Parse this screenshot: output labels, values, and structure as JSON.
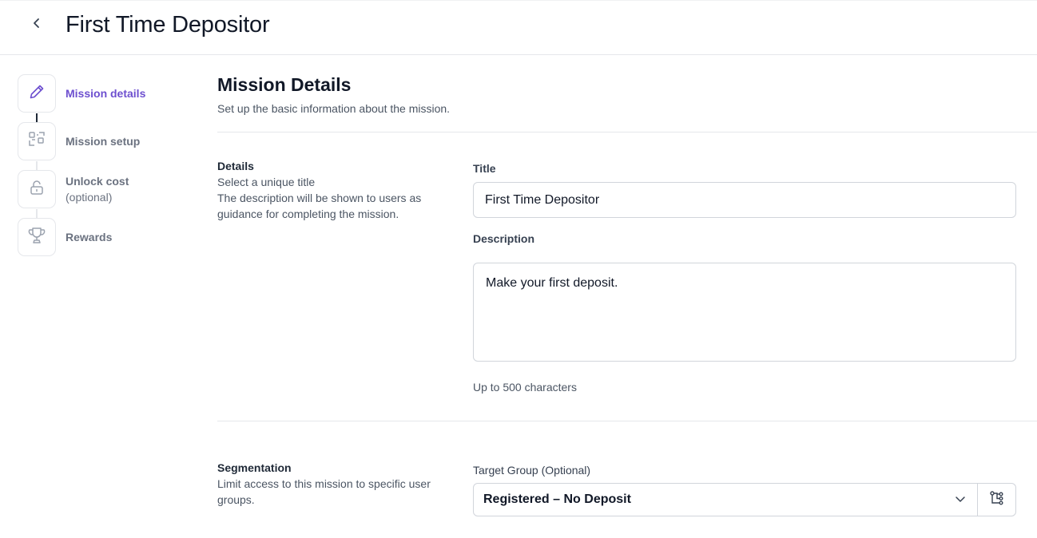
{
  "header": {
    "title": "First Time Depositor",
    "back_icon": "chevron-left-icon"
  },
  "steps": [
    {
      "label": "Mission details",
      "icon": "pencil-icon",
      "active": true
    },
    {
      "label": "Mission setup",
      "icon": "setup-icon",
      "active": false
    },
    {
      "label": "Unlock cost",
      "sublabel": "(optional)",
      "icon": "lock-icon",
      "active": false
    },
    {
      "label": "Rewards",
      "icon": "trophy-icon",
      "active": false
    }
  ],
  "section": {
    "title": "Mission Details",
    "subtitle": "Set up the basic information about the mission."
  },
  "details": {
    "title": "Details",
    "desc_line1": "Select a unique title",
    "desc_line2": "The description will be shown to users as guidance for completing the mission.",
    "title_label": "Title",
    "title_value": "First Time Depositor",
    "description_label": "Description",
    "description_value": "Make your first deposit.",
    "helper": "Up to 500 characters"
  },
  "segmentation": {
    "title": "Segmentation",
    "desc": "Limit access to this mission to specific user groups.",
    "target_label": "Target Group (Optional)",
    "target_value": "Registered – No Deposit"
  },
  "colors": {
    "accent": "#6d4fcf",
    "border": "#e5e7eb",
    "text": "#111827",
    "muted": "#6b7280"
  }
}
